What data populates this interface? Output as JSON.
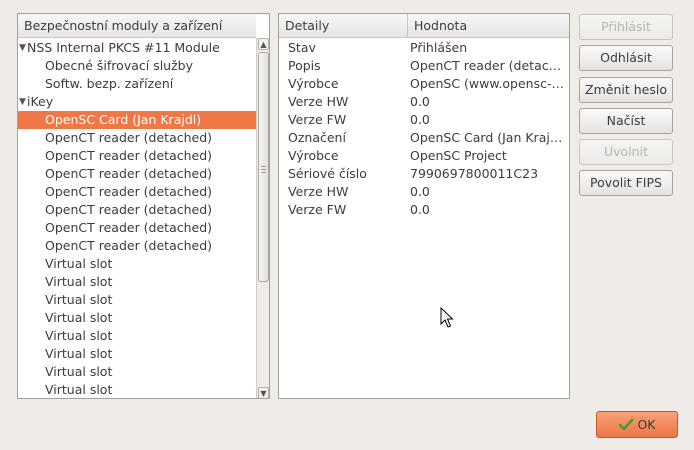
{
  "left_panel": {
    "column_header": "Bezpečnostní moduly a zařízení",
    "tree": [
      {
        "label": "NSS Internal PKCS #11 Module",
        "level": 0,
        "expanded": true
      },
      {
        "label": "Obecné šifrovací služby",
        "level": 1
      },
      {
        "label": "Softw. bezp. zařízení",
        "level": 1
      },
      {
        "label": "iKey",
        "level": 0,
        "expanded": true
      },
      {
        "label": "OpenSC Card (Jan Krajdl)",
        "level": 1,
        "selected": true
      },
      {
        "label": "OpenCT reader (detached)",
        "level": 1
      },
      {
        "label": "OpenCT reader (detached)",
        "level": 1
      },
      {
        "label": "OpenCT reader (detached)",
        "level": 1
      },
      {
        "label": "OpenCT reader (detached)",
        "level": 1
      },
      {
        "label": "OpenCT reader (detached)",
        "level": 1
      },
      {
        "label": "OpenCT reader (detached)",
        "level": 1
      },
      {
        "label": "OpenCT reader (detached)",
        "level": 1
      },
      {
        "label": "Virtual slot",
        "level": 1
      },
      {
        "label": "Virtual slot",
        "level": 1
      },
      {
        "label": "Virtual slot",
        "level": 1
      },
      {
        "label": "Virtual slot",
        "level": 1
      },
      {
        "label": "Virtual slot",
        "level": 1
      },
      {
        "label": "Virtual slot",
        "level": 1
      },
      {
        "label": "Virtual slot",
        "level": 1
      },
      {
        "label": "Virtual slot",
        "level": 1
      }
    ]
  },
  "right_panel": {
    "column_headers": [
      "Detaily",
      "Hodnota"
    ],
    "rows": [
      {
        "name": "Stav",
        "value": "Přihlášen"
      },
      {
        "name": "Popis",
        "value": "OpenCT reader (detach…"
      },
      {
        "name": "Výrobce",
        "value": "OpenSC (www.opensc-…"
      },
      {
        "name": "Verze HW",
        "value": "0.0"
      },
      {
        "name": "Verze FW",
        "value": "0.0"
      },
      {
        "name": "Označení",
        "value": "OpenSC Card (Jan Krajdl)"
      },
      {
        "name": "Výrobce",
        "value": "OpenSC Project"
      },
      {
        "name": "Sériové číslo",
        "value": "7990697800011C23"
      },
      {
        "name": "Verze HW",
        "value": "0.0"
      },
      {
        "name": "Verze FW",
        "value": "0.0"
      }
    ]
  },
  "buttons": [
    {
      "name": "login-button",
      "label": "Přihlásit",
      "enabled": false
    },
    {
      "name": "logout-button",
      "label": "Odhlásit",
      "enabled": true
    },
    {
      "name": "change-password-button",
      "label": "Změnit heslo",
      "enabled": true
    },
    {
      "name": "load-button",
      "label": "Načíst",
      "enabled": true
    },
    {
      "name": "unload-button",
      "label": "Uvolnit",
      "enabled": false
    },
    {
      "name": "enable-fips-button",
      "label": "Povolit FIPS",
      "enabled": true
    }
  ],
  "ok_button": {
    "label": "OK",
    "icon": "check-icon"
  },
  "colors": {
    "selection": "#f07746",
    "ok_button": "#ee7545"
  }
}
